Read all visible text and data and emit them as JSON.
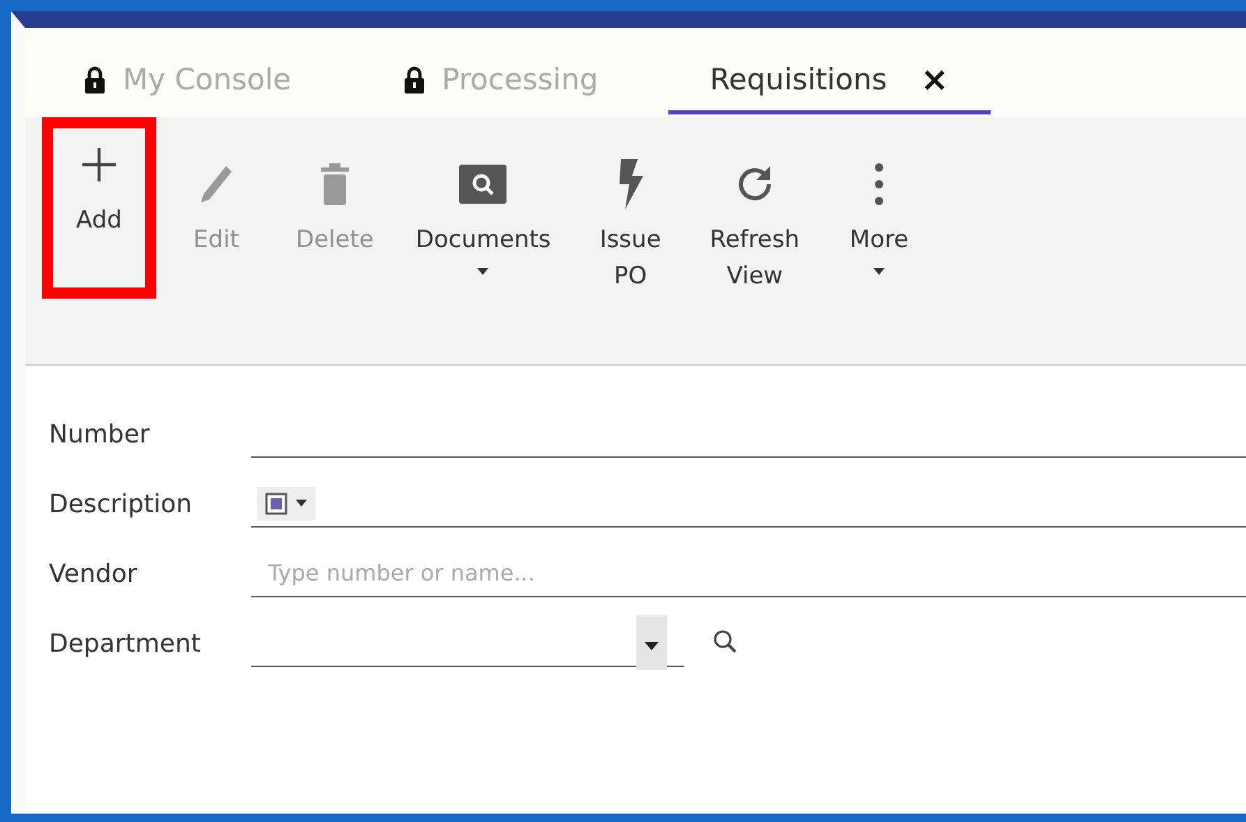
{
  "tabs": [
    {
      "label": "My Console",
      "selected": false,
      "locked": true,
      "closable": false
    },
    {
      "label": "Processing",
      "selected": false,
      "locked": true,
      "closable": false
    },
    {
      "label": "Requisitions",
      "selected": true,
      "locked": false,
      "closable": true,
      "close_glyph": "×"
    }
  ],
  "toolbar": [
    {
      "kind": "add",
      "label": "Add",
      "disabled": false,
      "dropdown": false,
      "highlighted": true
    },
    {
      "kind": "edit",
      "label": "Edit",
      "disabled": true,
      "dropdown": false,
      "highlighted": false
    },
    {
      "kind": "delete",
      "label": "Delete",
      "disabled": true,
      "dropdown": false,
      "highlighted": false
    },
    {
      "kind": "documents",
      "label": "Documents",
      "disabled": false,
      "dropdown": true,
      "highlighted": false
    },
    {
      "kind": "issue",
      "label": "Issue\nPO",
      "disabled": false,
      "dropdown": false,
      "highlighted": false
    },
    {
      "kind": "refresh",
      "label": "Refresh\nView",
      "disabled": false,
      "dropdown": false,
      "highlighted": false
    },
    {
      "kind": "more",
      "label": "More",
      "disabled": false,
      "dropdown": true,
      "highlighted": false
    }
  ],
  "form": [
    {
      "kind": "text",
      "label": "Number"
    },
    {
      "kind": "rich-text",
      "label": "Description"
    },
    {
      "kind": "text",
      "label": "Vendor",
      "placeholder": "Type number or name..."
    },
    {
      "kind": "dropdown",
      "label": "Department"
    }
  ]
}
